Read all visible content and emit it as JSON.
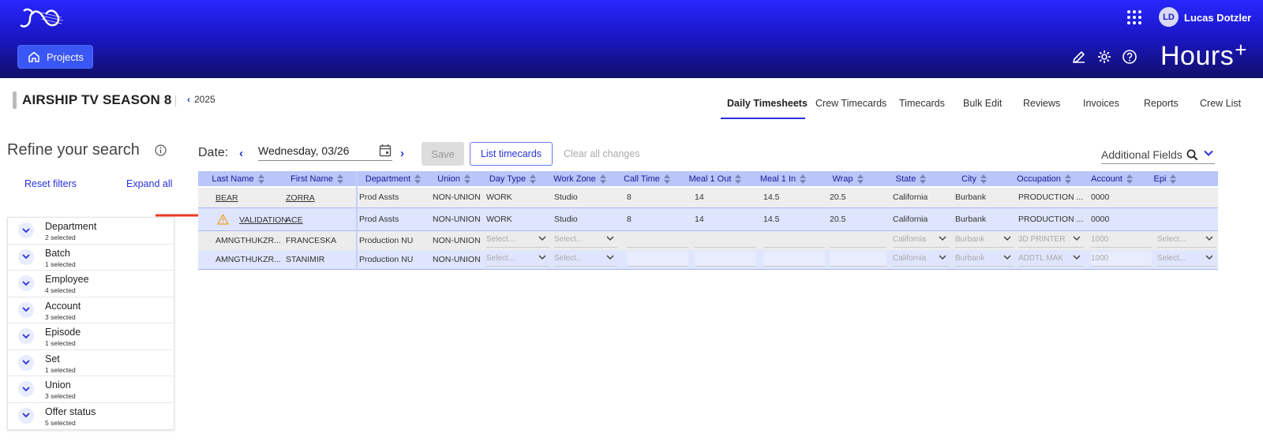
{
  "header": {
    "user_initials": "LD",
    "user_name": "Lucas Dotzler",
    "projects_label": "Projects",
    "brand": "Hours",
    "brand_sup": "+"
  },
  "project": {
    "title": "AIRSHIP TV SEASON 8",
    "year": "2025"
  },
  "tabs": [
    {
      "label": "Daily Timesheets",
      "active": true
    },
    {
      "label": "Crew Timecards"
    },
    {
      "label": "Timecards"
    },
    {
      "label": "Bulk Edit"
    },
    {
      "label": "Reviews"
    },
    {
      "label": "Invoices"
    },
    {
      "label": "Reports"
    },
    {
      "label": "Crew List"
    }
  ],
  "sidebar": {
    "title": "Refine your search",
    "reset_label": "Reset filters",
    "expand_label": "Expand all",
    "filters": [
      {
        "name": "Department",
        "sub": "2 selected"
      },
      {
        "name": "Batch",
        "sub": "1 selected"
      },
      {
        "name": "Employee",
        "sub": "4 selected"
      },
      {
        "name": "Account",
        "sub": "3 selected"
      },
      {
        "name": "Episode",
        "sub": "1 selected"
      },
      {
        "name": "Set",
        "sub": "1 selected"
      },
      {
        "name": "Union",
        "sub": "3 selected"
      },
      {
        "name": "Offer status",
        "sub": "5 selected"
      }
    ]
  },
  "controls": {
    "date_label": "Date:",
    "date_value": "Wednesday, 03/26",
    "save_label": "Save",
    "list_label": "List timecards",
    "clear_label": "Clear all changes",
    "additional_fields": "Additional Fields"
  },
  "table": {
    "columns": [
      "Last Name",
      "First Name",
      "Department",
      "Union",
      "Day Type",
      "Work Zone",
      "Call Time",
      "Meal 1 Out",
      "Meal 1 In",
      "Wrap",
      "State",
      "City",
      "Occupation",
      "Account",
      "Epi"
    ],
    "rows": [
      {
        "last": "BEAR",
        "first": "ZORRA",
        "dept": "Prod Assts",
        "union": "NON-UNION",
        "day_type": "WORK",
        "work_zone": "Studio",
        "call": "8",
        "meal_out": "14",
        "meal_in": "14.5",
        "wrap": "20.5",
        "state": "California",
        "city": "Burbank",
        "occupation": "PRODUCTION ...",
        "account": "0000"
      },
      {
        "last": "VALIDATION",
        "first": "ACE",
        "dept": "Prod Assts",
        "union": "NON-UNION",
        "day_type": "WORK",
        "work_zone": "Studio",
        "call": "8",
        "meal_out": "14",
        "meal_in": "14.5",
        "wrap": "20.5",
        "state": "California",
        "city": "Burbank",
        "occupation": "PRODUCTION ...",
        "account": "0000"
      },
      {
        "last": "AMNGTHUKZR...",
        "first": "FRANCESKA",
        "dept": "Production NU",
        "union": "NON-UNION",
        "day_type": "Select...",
        "work_zone": "Select...",
        "state": "California",
        "city": "Burbank",
        "occupation": "3D PRINTER",
        "account": "1000",
        "epi": "Select..."
      },
      {
        "last": "AMNGTHUKZR...",
        "first": "STANIMIR",
        "dept": "Production NU",
        "union": "NON-UNION",
        "day_type": "Select...",
        "work_zone": "Select...",
        "state": "California",
        "city": "Burbank",
        "occupation": "ADDTL MAK",
        "account": "1000",
        "epi": "Select..."
      }
    ]
  },
  "colors": {
    "accent": "#2a32d8",
    "header_top": "#2727ff",
    "header_bottom": "#11106a",
    "table_header": "#b9c6fa",
    "selected_row": "#dfe5fc",
    "warning": "#f0a030",
    "arrow": "#e83a22"
  }
}
